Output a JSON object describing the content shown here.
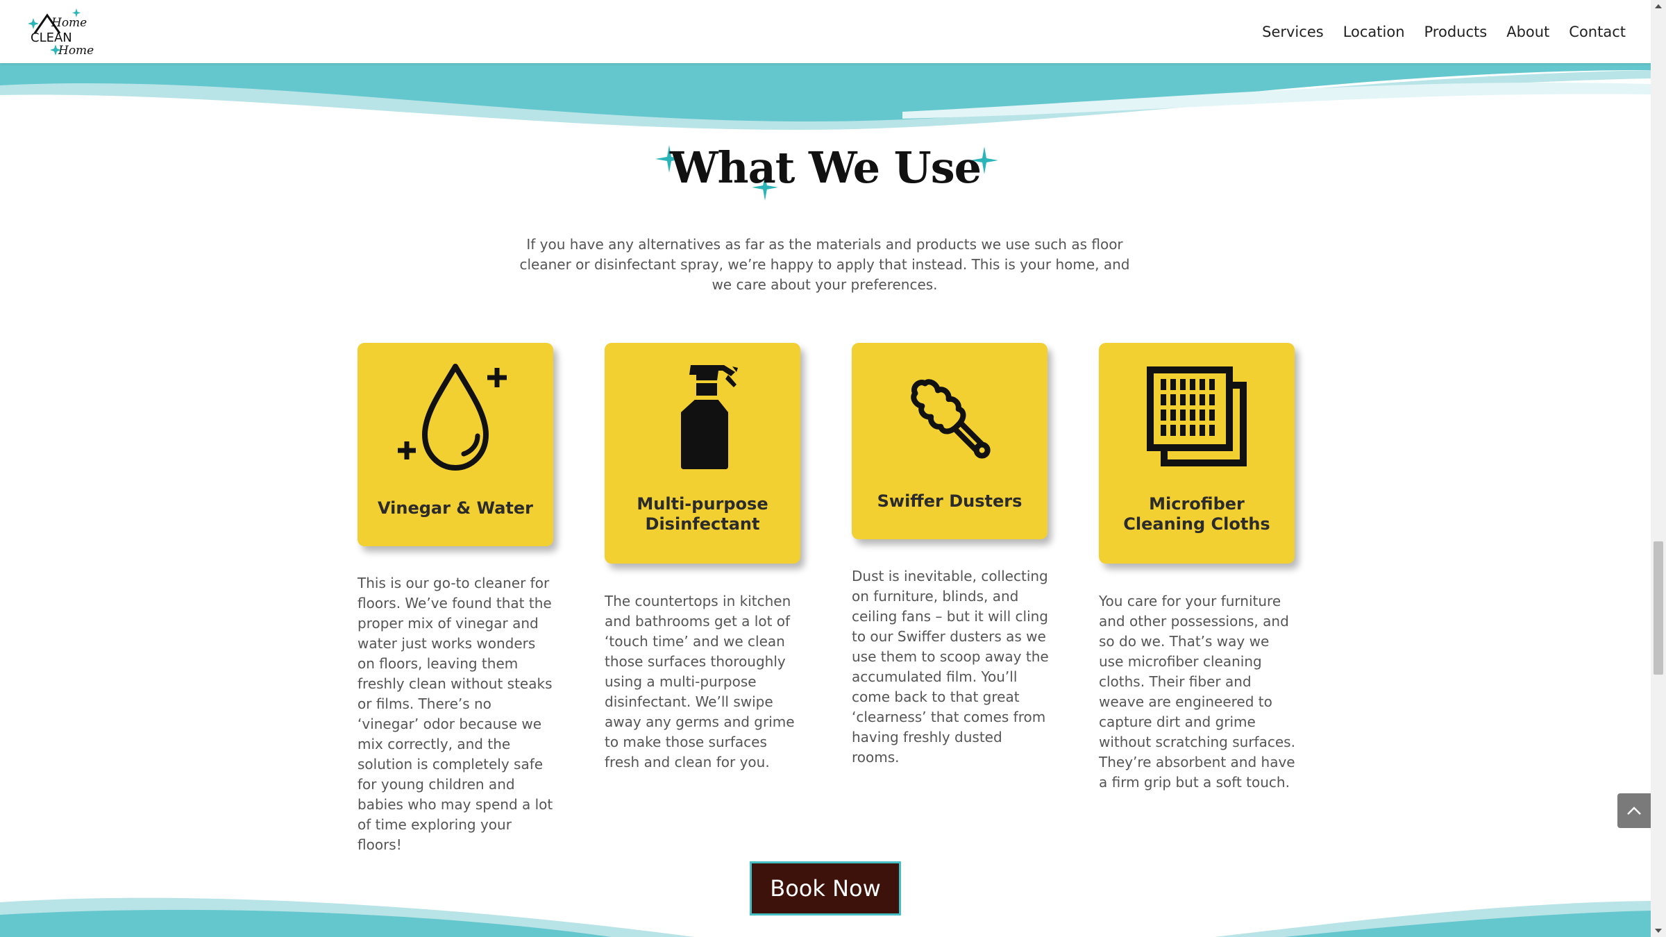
{
  "header": {
    "logo_alt": "Home CLEAN Home",
    "nav": [
      "Services",
      "Location",
      "Products",
      "About",
      "Contact"
    ]
  },
  "section": {
    "title": "What We Use",
    "intro": "If you have any alternatives as far as the materials and products we use such as floor cleaner or disinfectant spray, we’re happy to apply that instead. This is your home, and we care about your preferences."
  },
  "cards": [
    {
      "icon": "water-drop-icon",
      "title": "Vinegar & Water",
      "description": "This is our go-to cleaner for floors. We’ve found that the proper mix of vinegar and water just works wonders on floors, leaving them freshly clean without steaks or films. There’s no ‘vinegar’ odor because we mix correctly, and the solution is completely safe for young children and babies who may spend a lot of time exploring your floors!"
    },
    {
      "icon": "spray-bottle-icon",
      "title": "Multi-purpose Disinfectant",
      "description": "The countertops in kitchen and bathrooms get a lot of ‘touch time’ and we clean those surfaces thoroughly using a multi-purpose disinfectant. We’ll swipe away any germs and grime to make those surfaces fresh and clean for you."
    },
    {
      "icon": "duster-icon",
      "title": "Swiffer Dusters",
      "description": "Dust is inevitable, collecting on furniture, blinds, and ceiling fans – but it will cling to our Swiffer dusters as we use them to scoop away the accumulated film. You’ll come back to that great ‘clearness’ that comes from having freshly dusted rooms."
    },
    {
      "icon": "cloth-icon",
      "title": "Microfiber Cleaning Cloths",
      "description": "You care for your furniture and other possessions, and so do we. That’s way we use microfiber cleaning cloths. Their fiber and weave are engineered to capture dirt and grime without scratching surfaces. They’re absorbent and have a firm grip but a soft touch."
    }
  ],
  "cta": {
    "label": "Book Now"
  },
  "colors": {
    "card": "#f2d031",
    "accent": "#45bfc4",
    "button": "#3d120b"
  }
}
